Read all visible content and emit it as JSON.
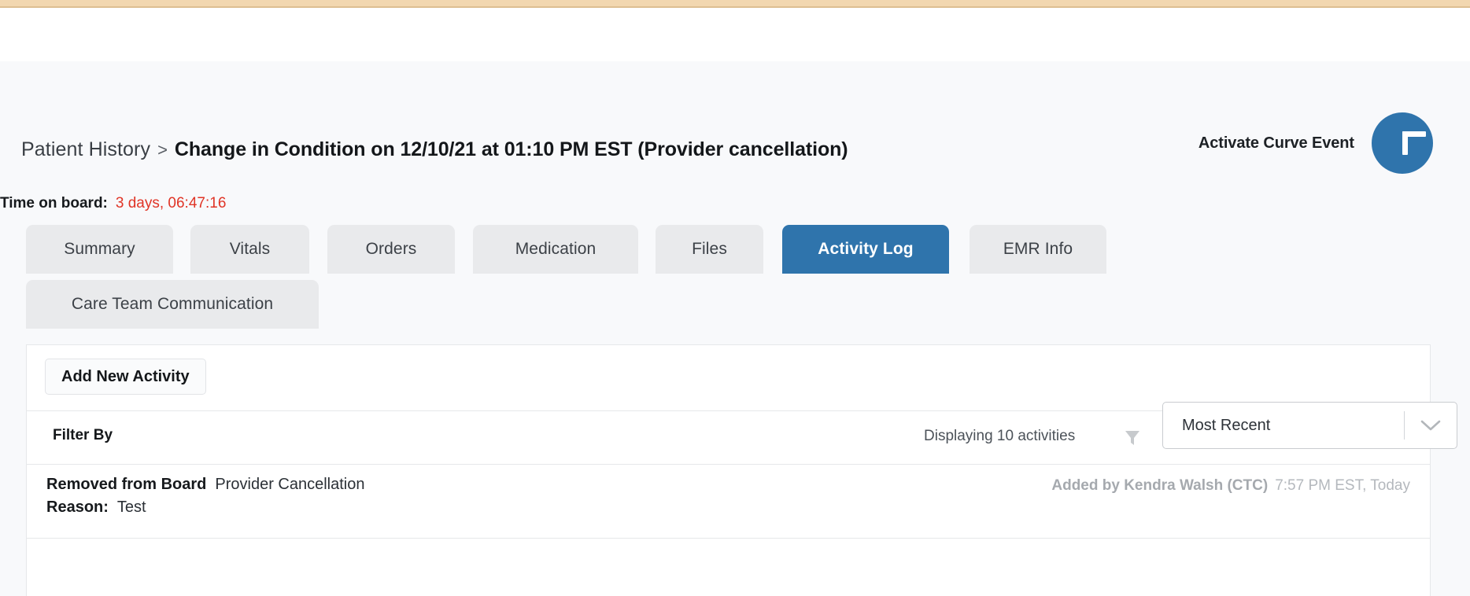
{
  "header": {
    "breadcrumb_root": "Patient History",
    "breadcrumb_separator": ">",
    "breadcrumb_current": "Change in Condition on 12/10/21 at 01:10 PM EST (Provider cancellation)",
    "activate_label": "Activate Curve Event",
    "fab_icon": "plus-icon",
    "accent_color": "#2f74ac",
    "top_bar_color": "#f2d7b0"
  },
  "time_on_board": {
    "label": "Time on board:",
    "value": "3 days, 06:47:16",
    "value_color": "#e03426"
  },
  "tabs": [
    {
      "label": "Summary",
      "active": false
    },
    {
      "label": "Vitals",
      "active": false
    },
    {
      "label": "Orders",
      "active": false
    },
    {
      "label": "Medication",
      "active": false
    },
    {
      "label": "Files",
      "active": false
    },
    {
      "label": "Activity Log",
      "active": true
    },
    {
      "label": "EMR Info",
      "active": false
    },
    {
      "label": "Care Team Communication",
      "active": false
    }
  ],
  "activity_log": {
    "add_button_label": "Add New Activity",
    "filter_by_label": "Filter By",
    "displaying_text": "Displaying 10 activities",
    "filter_icon": "funnel-icon",
    "sort": {
      "selected": "Most Recent",
      "caret_icon": "chevron-down-icon",
      "options": [
        "Most Recent"
      ]
    },
    "entries": [
      {
        "title": "Removed from Board",
        "subject": "Provider Cancellation",
        "reason_label": "Reason:",
        "reason_value": "Test",
        "author": "Added by Kendra Walsh (CTC)",
        "timestamp": "7:57 PM EST, Today"
      }
    ]
  }
}
